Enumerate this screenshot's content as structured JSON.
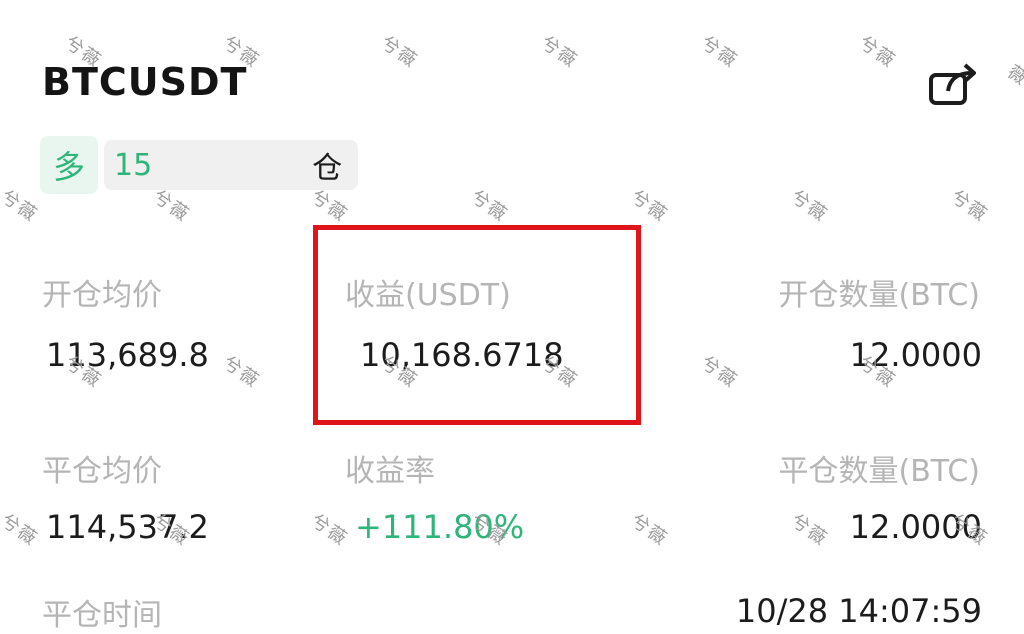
{
  "header": {
    "symbol": "BTCUSDT"
  },
  "position": {
    "side": "多",
    "leverage_prefix": "15",
    "mode_suffix": "仓"
  },
  "fields": {
    "entry_price_label": "开仓均价",
    "entry_price_value": "113,689.8",
    "pnl_label": "收益(USDT)",
    "pnl_value": "10,168.6718",
    "open_qty_label": "开仓数量(BTC)",
    "open_qty_value": "12.0000",
    "close_price_label": "平仓均价",
    "close_price_value": "114,537.2",
    "roe_label": "收益率",
    "roe_value": "+111.80%",
    "close_qty_label": "平仓数量(BTC)",
    "close_qty_value": "12.0000",
    "time_label": "平仓时间",
    "time_value": "10/28 14:07:59"
  },
  "watermark": "兮薇",
  "colors": {
    "accent_green": "#2fb47a",
    "highlight_red": "#e0141b"
  },
  "icons": {
    "share": "share-icon"
  }
}
